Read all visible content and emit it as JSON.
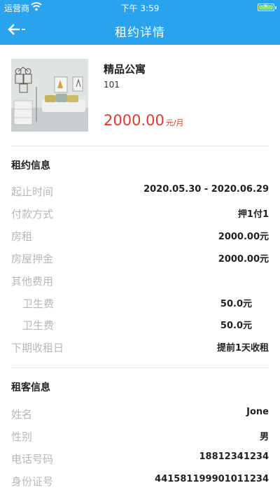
{
  "status_bar": {
    "carrier": "运营商",
    "time": "下午 3:59"
  },
  "nav": {
    "title": "租约详情"
  },
  "product": {
    "name": "精品公寓",
    "room": "101",
    "price": "2000.00",
    "price_unit": "元/月"
  },
  "lease": {
    "title": "租约信息",
    "rows": [
      {
        "label": "起止时间",
        "value": "2020.05.30 - 2020.06.29"
      },
      {
        "label": "付款方式",
        "value": "押1付1"
      },
      {
        "label": "房租",
        "value": "2000.00元"
      },
      {
        "label": "房屋押金",
        "value": "2000.00元"
      },
      {
        "label": "其他费用",
        "value": ""
      },
      {
        "label": "卫生费",
        "value": "50.0元"
      },
      {
        "label": "卫生费",
        "value": "50.0元"
      },
      {
        "label": "下期收租日",
        "value": "提前1天收租"
      }
    ]
  },
  "tenant": {
    "title": "租客信息",
    "rows": [
      {
        "label": "姓名",
        "value": "Jone"
      },
      {
        "label": "性别",
        "value": "男"
      },
      {
        "label": "电话号码",
        "value": "18812341234"
      },
      {
        "label": "身份证号",
        "value": "441581199901011234"
      }
    ]
  },
  "colors": {
    "header": "#2aa3ee",
    "price": "#e03c2c",
    "label": "#b8b8b8"
  }
}
